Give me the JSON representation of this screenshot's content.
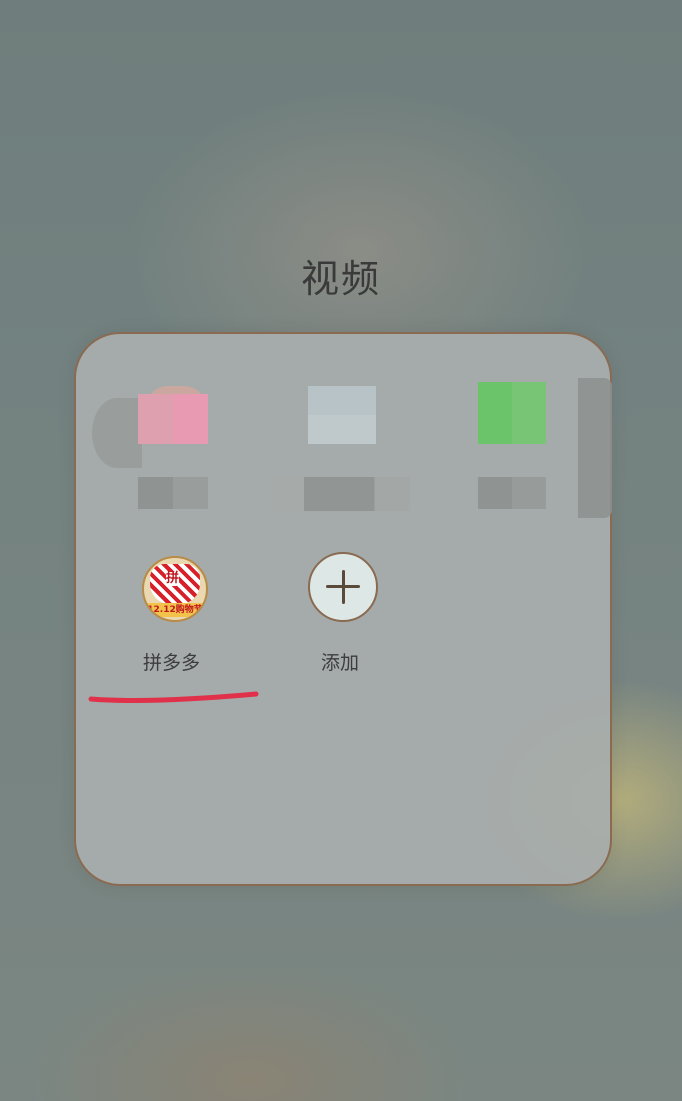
{
  "folder": {
    "title": "视频"
  },
  "apps": [
    {
      "label": "拼多多",
      "icon": "pinduoduo-icon",
      "badge_text": "12.12购物节",
      "glyph": "拼"
    },
    {
      "label": "添加",
      "icon": "plus-icon"
    }
  ],
  "colors": {
    "annotation": "#e0304a",
    "folder_border": "#8a6a50",
    "pdd_red": "#d8202a",
    "pdd_yellow": "#f2c24b"
  }
}
